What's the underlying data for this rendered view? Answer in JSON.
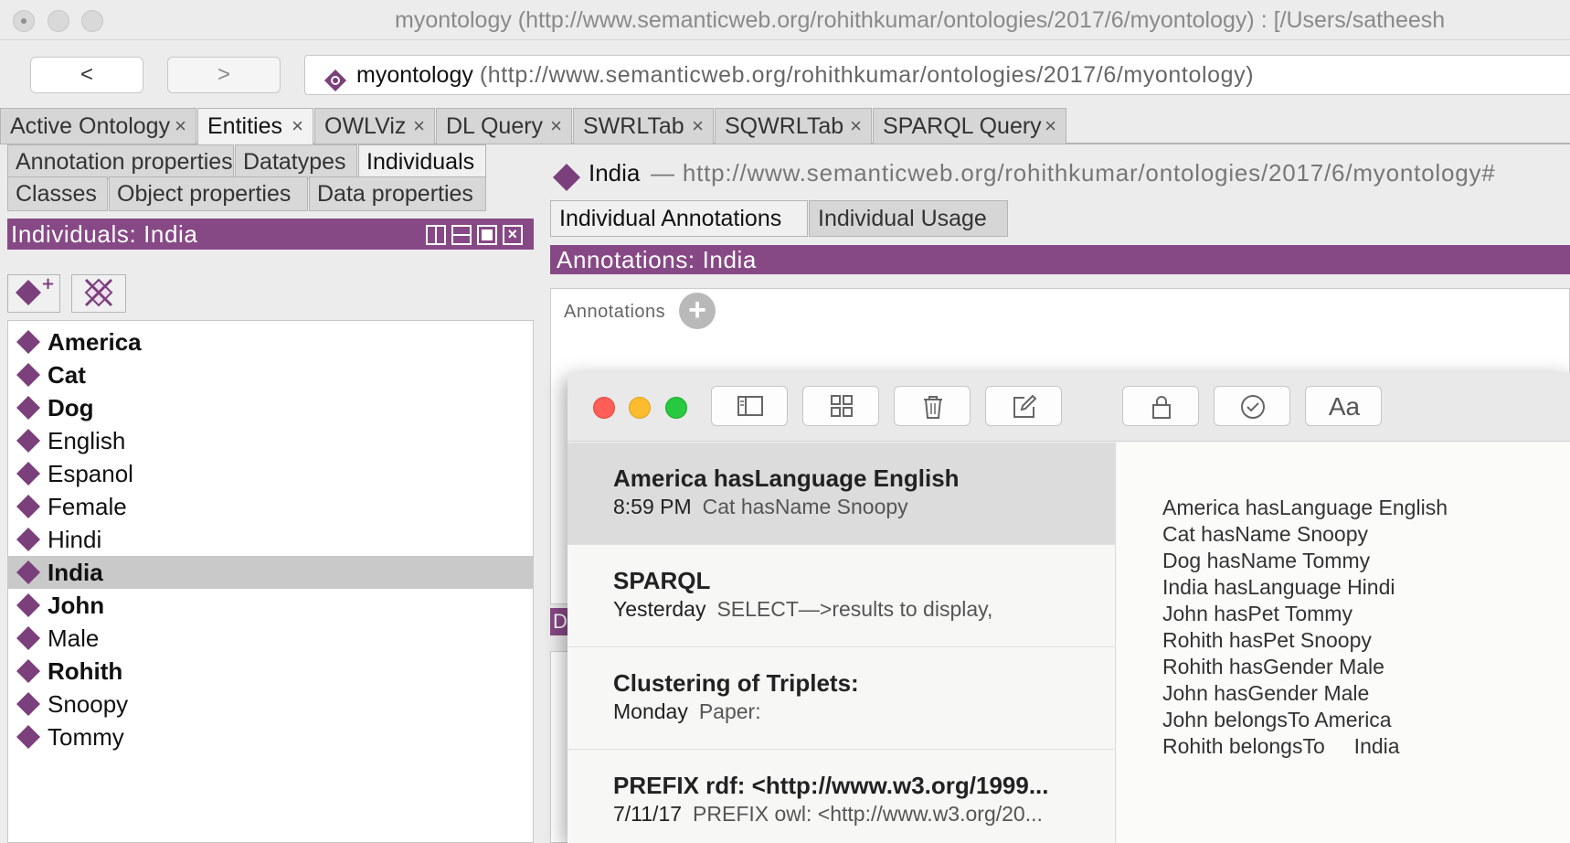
{
  "window": {
    "title": "myontology (http://www.semanticweb.org/rohithkumar/ontologies/2017/6/myontology)  : [/Users/satheesh"
  },
  "nav": {
    "back_label": "<",
    "forward_label": ">",
    "ontology_name": "myontology",
    "ontology_iri": "(http://www.semanticweb.org/rohithkumar/ontologies/2017/6/myontology)"
  },
  "tabs": [
    {
      "label": "Active Ontology",
      "close": "×"
    },
    {
      "label": "Entities",
      "close": "×"
    },
    {
      "label": "OWLViz",
      "close": "×"
    },
    {
      "label": "DL Query",
      "close": "×"
    },
    {
      "label": "SWRLTab",
      "close": "×"
    },
    {
      "label": "SQWRLTab",
      "close": "×"
    },
    {
      "label": "SPARQL Query",
      "close": "×"
    }
  ],
  "left": {
    "subtabs": [
      "Annotation properties",
      "Datatypes",
      "Individuals",
      "Classes",
      "Object properties",
      "Data properties"
    ],
    "panel_title": "Individuals: India",
    "individuals": [
      {
        "label": "America",
        "bold": true
      },
      {
        "label": "Cat",
        "bold": true
      },
      {
        "label": "Dog",
        "bold": true
      },
      {
        "label": "English",
        "bold": false
      },
      {
        "label": "Espanol",
        "bold": false
      },
      {
        "label": "Female",
        "bold": false
      },
      {
        "label": "Hindi",
        "bold": false
      },
      {
        "label": "India",
        "bold": true,
        "selected": true
      },
      {
        "label": "John",
        "bold": true
      },
      {
        "label": "Male",
        "bold": false
      },
      {
        "label": "Rohith",
        "bold": true
      },
      {
        "label": "Snoopy",
        "bold": false
      },
      {
        "label": "Tommy",
        "bold": false
      }
    ]
  },
  "right": {
    "entity_name": "India",
    "entity_iri": "— http://www.semanticweb.org/rohithkumar/ontologies/2017/6/myontology#",
    "tabs": [
      "Individual Annotations",
      "Individual Usage"
    ],
    "panel_title": "Annotations: India",
    "annotations_label": "Annotations",
    "add_symbol": "+",
    "stub_letter": "D"
  },
  "notes_app": {
    "format_button_label": "Aa",
    "notes": [
      {
        "title": "America hasLanguage English",
        "date": "8:59 PM",
        "preview": "Cat hasName Snoopy"
      },
      {
        "title": "SPARQL",
        "date": "Yesterday",
        "preview": "SELECT—>results to display,"
      },
      {
        "title": "Clustering of Triplets:",
        "date": "Monday",
        "preview": "Paper:"
      },
      {
        "title": "PREFIX rdf: <http://www.w3.org/1999...",
        "date": "7/11/17",
        "preview": "PREFIX owl: <http://www.w3.org/20..."
      }
    ],
    "content_lines": [
      "America hasLanguage English",
      "Cat hasName Snoopy",
      "Dog hasName Tommy",
      "India hasLanguage Hindi",
      "John hasPet Tommy",
      "Rohith hasPet Snoopy",
      "Rohith hasGender Male",
      "John hasGender Male",
      "John belongsTo America",
      "Rohith belongsTo     India"
    ]
  },
  "colors": {
    "accent_purple": "#874986",
    "individual_icon": "#7b3f7b"
  }
}
